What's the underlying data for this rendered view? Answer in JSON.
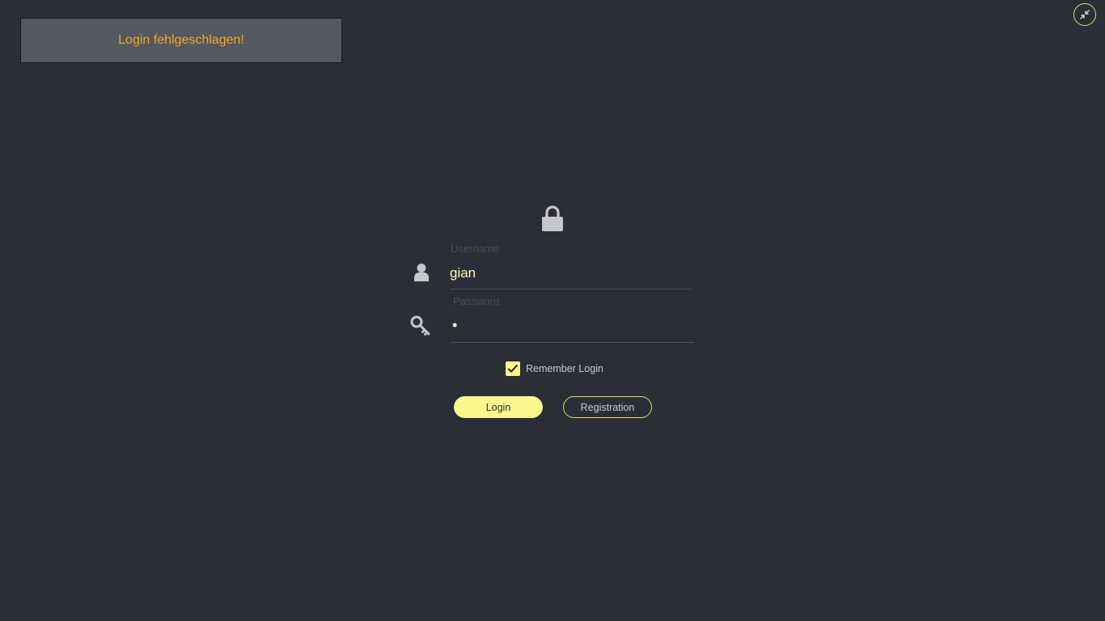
{
  "notification": {
    "message": "Login fehlgeschlagen!"
  },
  "window": {
    "minimize_icon": "collapse-arrows-icon"
  },
  "form": {
    "lock_icon": "lock-icon",
    "username": {
      "label": "Username",
      "value": "gian",
      "icon": "user-icon"
    },
    "password": {
      "label": "Password",
      "masked_value": "•",
      "icon": "key-icon"
    },
    "remember": {
      "label": "Remember Login",
      "checked": true
    },
    "buttons": {
      "login": "Login",
      "register": "Registration"
    }
  },
  "colors": {
    "background": "#2a2e37",
    "accent": "#fbf68e",
    "error_text": "#f5a623",
    "toast_bg": "#535861"
  }
}
